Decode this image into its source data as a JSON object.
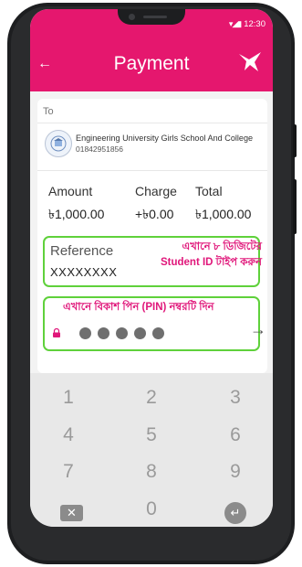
{
  "status_bar": {
    "time": "12:30"
  },
  "header": {
    "title": "Payment"
  },
  "recipient": {
    "to_label": "To",
    "name": "Engineering University Girls School And College",
    "phone": "01842951856"
  },
  "summary": {
    "amount_label": "Amount",
    "amount_value": "৳1,000.00",
    "charge_label": "Charge",
    "charge_value": "+৳0.00",
    "total_label": "Total",
    "total_value": "৳1,000.00"
  },
  "reference": {
    "label": "Reference",
    "value": "XXXXXXXX",
    "hint_line1": "এখানে ৮ ডিজিটের",
    "hint_line2": "Student ID টাইপ করুন"
  },
  "pin": {
    "hint": "এখানে বিকাশ পিন (PIN) নম্বরটি দিন",
    "digits_entered": 5,
    "arrow": "→"
  },
  "keypad": {
    "keys": [
      "1",
      "2",
      "3",
      "4",
      "5",
      "6",
      "7",
      "8",
      "9",
      "0"
    ]
  },
  "colors": {
    "brand": "#e5176e",
    "highlight_border": "#5fd13b",
    "hint_text": "#e0167a"
  },
  "icons": [
    "back-arrow-icon",
    "bkash-bird-logo-icon",
    "lock-icon",
    "submit-arrow-icon",
    "backspace-icon",
    "enter-icon"
  ]
}
